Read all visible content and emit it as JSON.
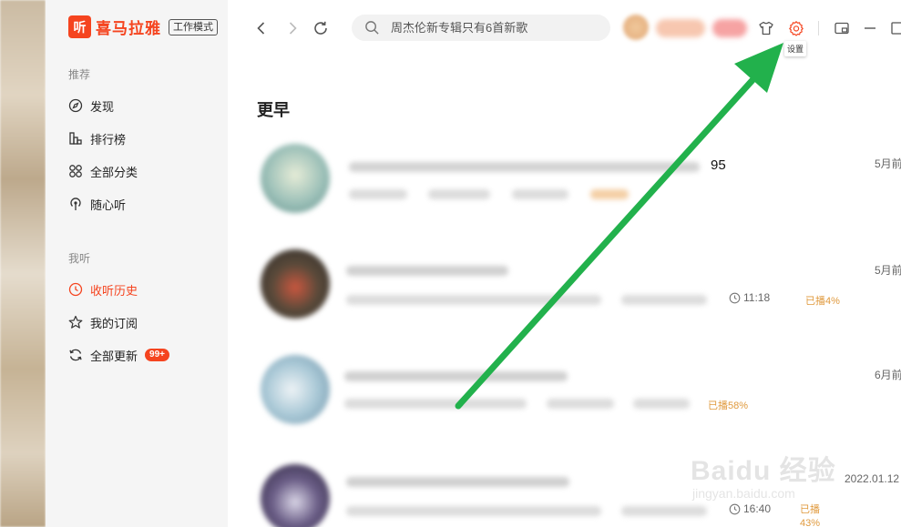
{
  "brand": {
    "logo_glyph": "听",
    "name": "喜马拉雅",
    "mode_badge": "工作模式",
    "accent": "#f5441f"
  },
  "sidebar": {
    "sections": [
      {
        "label": "推荐",
        "items": [
          {
            "label": "发现",
            "icon": "compass-icon"
          },
          {
            "label": "排行榜",
            "icon": "chart-icon"
          },
          {
            "label": "全部分类",
            "icon": "grid-icon"
          },
          {
            "label": "随心听",
            "icon": "radio-icon"
          }
        ]
      },
      {
        "label": "我听",
        "items": [
          {
            "label": "收听历史",
            "icon": "clock-icon",
            "active": true
          },
          {
            "label": "我的订阅",
            "icon": "star-icon"
          },
          {
            "label": "全部更新",
            "icon": "refresh-icon",
            "badge": "99+"
          }
        ]
      }
    ]
  },
  "topbar": {
    "search_placeholder": "周杰伦新专辑只有6首新歌",
    "settings_tooltip": "设置",
    "icons": [
      "back-icon",
      "forward-icon",
      "reload-icon",
      "skin-icon",
      "settings-icon",
      "mini-mode-icon",
      "minimize-icon",
      "maximize-icon"
    ]
  },
  "history": {
    "section_title": "更早",
    "items": [
      {
        "title_tail": "95",
        "date": "5月前"
      },
      {
        "date": "5月前",
        "duration": "11:18",
        "progress": "已播4%"
      },
      {
        "date": "6月前",
        "progress": "已播58%"
      },
      {
        "date": "2022.01.12",
        "duration": "16:40",
        "progress": "已播43%"
      }
    ]
  },
  "arrow_color": "#22b14c",
  "watermark": {
    "main": "Baidu 经验",
    "sub": "jingyan.baidu.com"
  }
}
